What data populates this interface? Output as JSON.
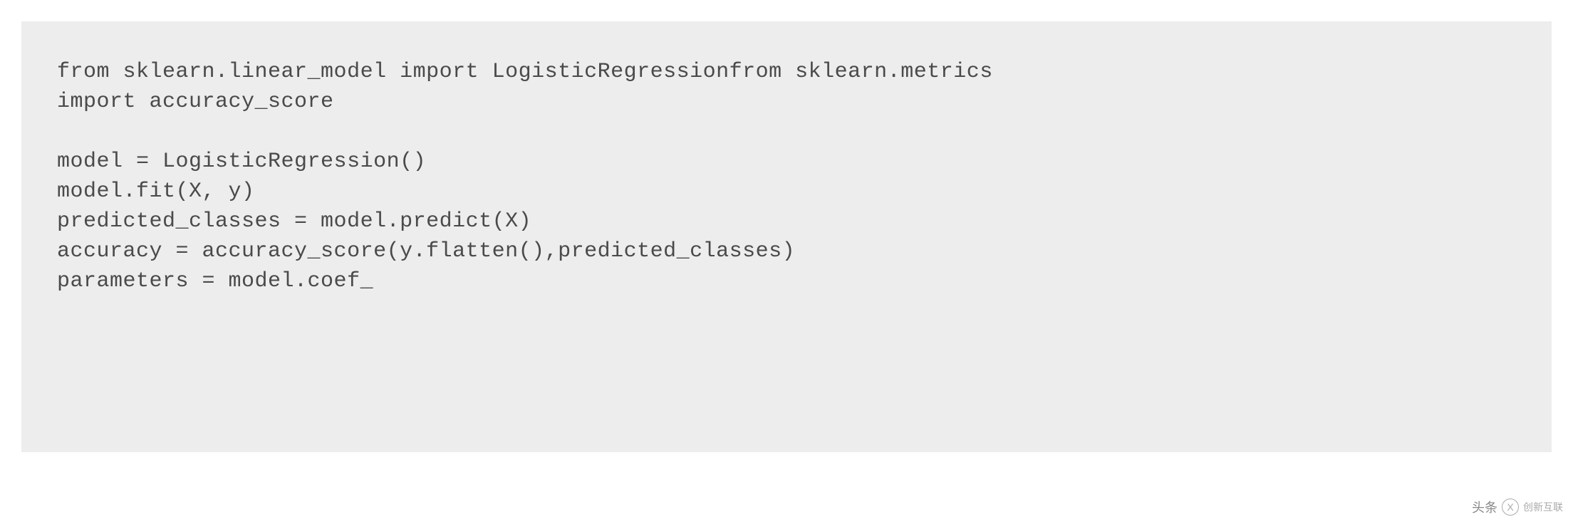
{
  "code": {
    "line1": "from sklearn.linear_model import LogisticRegressionfrom sklearn.metrics",
    "line2": "import accuracy_score",
    "line3": "",
    "line4": "model = LogisticRegression()",
    "line5": "model.fit(X, y)",
    "line6": "predicted_classes = model.predict(X)",
    "line7": "accuracy = accuracy_score(y.flatten(),predicted_classes)",
    "line8": "parameters = model.coef_"
  },
  "watermark": {
    "source": "头条",
    "logo_letter": "X",
    "brand": "创新互联"
  }
}
